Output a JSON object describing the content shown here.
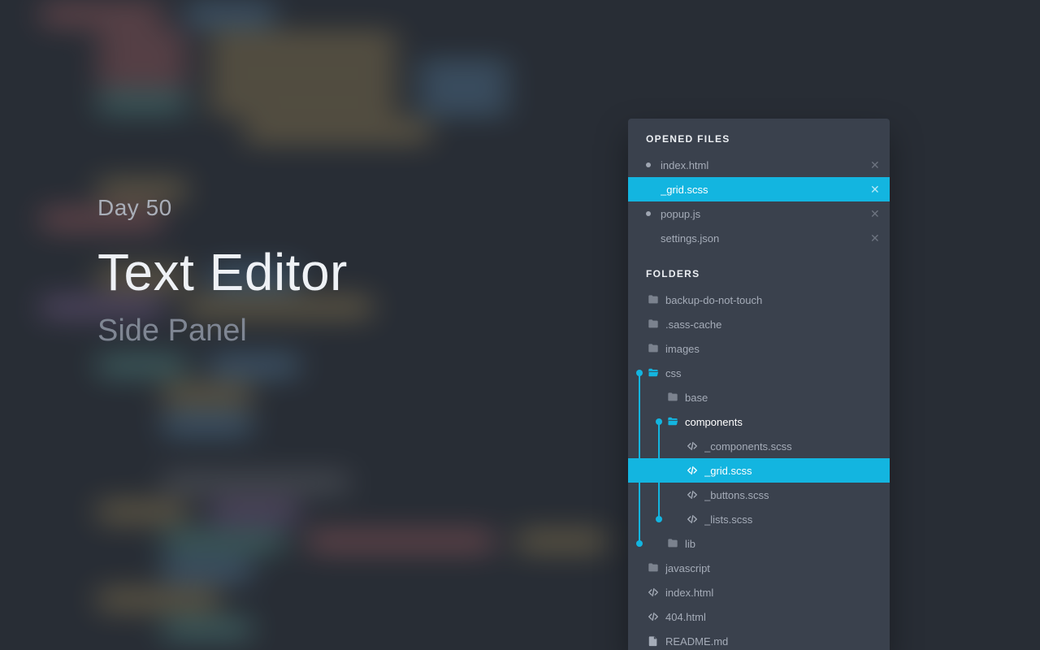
{
  "hero": {
    "kicker": "Day 50",
    "title": "Text Editor",
    "subtitle": "Side Panel"
  },
  "panel": {
    "opened_header": "OPENED FILES",
    "folders_header": "FOLDERS",
    "opened": [
      {
        "name": "index.html",
        "dirty": true,
        "active": false
      },
      {
        "name": "_grid.scss",
        "dirty": false,
        "active": true
      },
      {
        "name": "popup.js",
        "dirty": true,
        "active": false
      },
      {
        "name": "settings.json",
        "dirty": false,
        "active": false
      }
    ],
    "tree": [
      {
        "depth": 0,
        "icon": "folder",
        "label": "backup-do-not-touch",
        "dim": true
      },
      {
        "depth": 0,
        "icon": "folder",
        "label": ".sass-cache",
        "dim": true
      },
      {
        "depth": 0,
        "icon": "folder",
        "label": "images",
        "dim": true
      },
      {
        "depth": 0,
        "icon": "folder-open",
        "label": "css",
        "accent": true,
        "conn_outer": true
      },
      {
        "depth": 1,
        "icon": "folder",
        "label": "base",
        "dim": true
      },
      {
        "depth": 1,
        "icon": "folder-open",
        "label": "components",
        "accent": true,
        "light": true,
        "conn_inner": true
      },
      {
        "depth": 2,
        "icon": "code",
        "label": "_components.scss"
      },
      {
        "depth": 2,
        "icon": "code",
        "label": "_grid.scss",
        "active": true
      },
      {
        "depth": 2,
        "icon": "code",
        "label": "_buttons.scss"
      },
      {
        "depth": 2,
        "icon": "code",
        "label": "_lists.scss",
        "conn_inner_end": true
      },
      {
        "depth": 1,
        "icon": "folder",
        "label": "lib",
        "dim": true,
        "conn_outer_end": true
      },
      {
        "depth": 0,
        "icon": "folder",
        "label": "javascript",
        "dim": true
      },
      {
        "depth": 0,
        "icon": "code",
        "label": "index.html"
      },
      {
        "depth": 0,
        "icon": "code",
        "label": "404.html"
      },
      {
        "depth": 0,
        "icon": "file",
        "label": "README.md"
      }
    ]
  },
  "colors": {
    "accent": "#13b5e0",
    "panel_bg": "#3a414d",
    "page_bg": "#282d35"
  }
}
